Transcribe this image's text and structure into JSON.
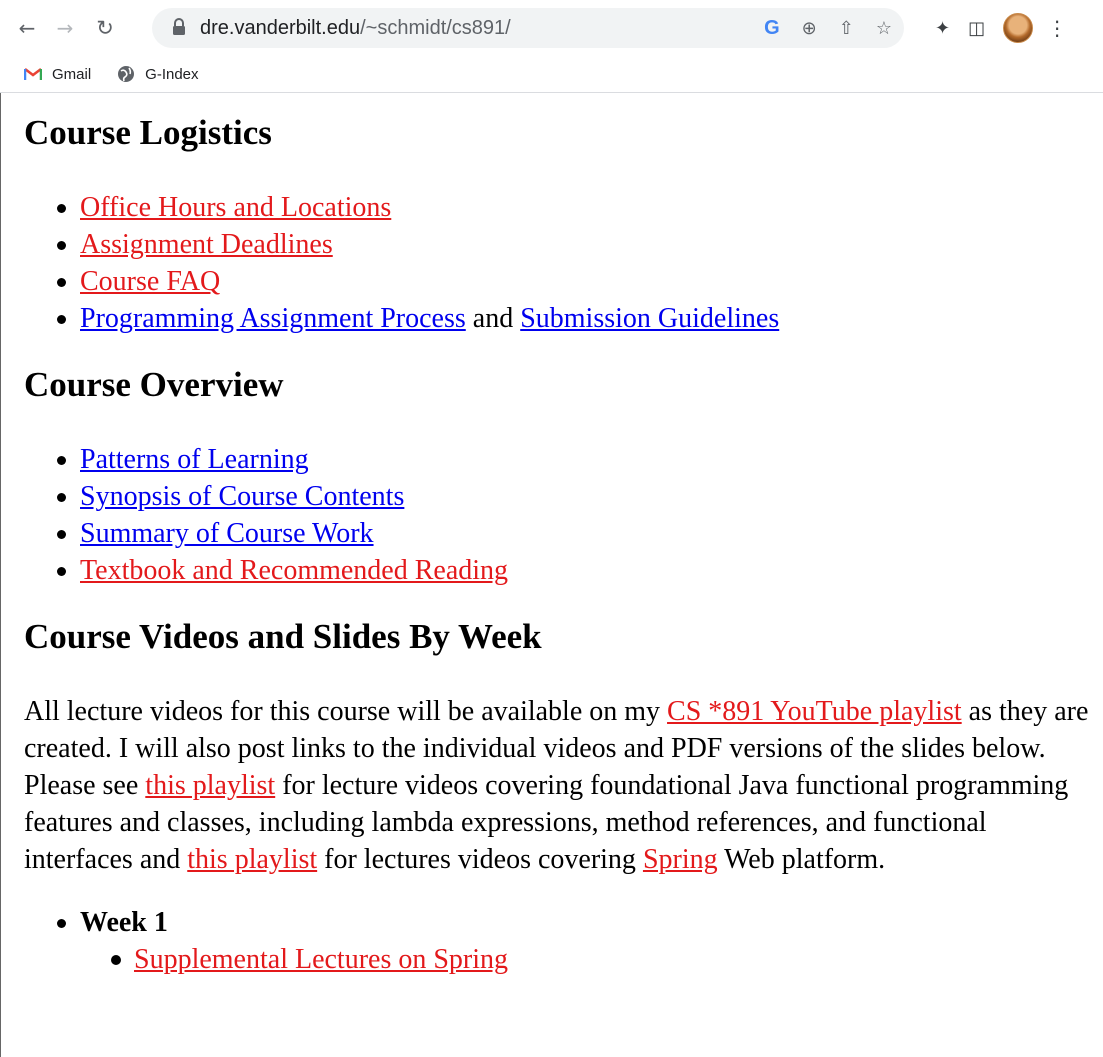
{
  "browser": {
    "url_host": "dre.vanderbilt.edu",
    "url_path": "/~schmidt/cs891/",
    "icons": [
      "back-icon",
      "forward-icon",
      "reload-icon",
      "lock-icon",
      "google-icon",
      "zoom-icon",
      "share-icon",
      "star-icon",
      "extensions-icon",
      "sidepanel-icon",
      "avatar",
      "menu-icon"
    ],
    "bookmarks": [
      {
        "label": "Gmail",
        "icon": "gmail-icon"
      },
      {
        "label": "G-Index",
        "icon": "globe-icon"
      }
    ],
    "google_letter": "G"
  },
  "sections": {
    "logistics": {
      "title": "Course Logistics",
      "items": [
        {
          "label": "Office Hours and Locations",
          "color": "red"
        },
        {
          "label": "Assignment Deadlines",
          "color": "red"
        },
        {
          "label": "Course FAQ",
          "color": "red"
        },
        {
          "label": "Programming Assignment Process",
          "color": "blue",
          "joiner": "and",
          "label2": "Submission Guidelines",
          "color2": "blue"
        }
      ]
    },
    "overview": {
      "title": "Course Overview",
      "items": [
        {
          "label": "Patterns of Learning",
          "color": "blue"
        },
        {
          "label": "Synopsis of Course Contents",
          "color": "blue"
        },
        {
          "label": "Summary of Course Work",
          "color": "blue"
        },
        {
          "label": "Textbook and Recommended Reading",
          "color": "red"
        }
      ]
    },
    "videos": {
      "title": "Course Videos and Slides By Week",
      "intro": {
        "t1": "All lecture videos for this course will be available on my ",
        "link1": "CS *891 YouTube playlist",
        "t2": " as they are created. I will also post links to the individual videos and PDF versions of the slides below. Please see ",
        "link2": "this playlist",
        "t3": " for lecture videos covering foundational Java functional programming features and classes, including lambda expressions, method references, and functional interfaces and ",
        "link3": "this playlist",
        "t4": " for lectures videos covering ",
        "link4": "Spring",
        "t5": " Web platform."
      },
      "weeks": [
        {
          "label": "Week 1",
          "items": [
            "Supplemental Lectures on Spring"
          ]
        }
      ]
    }
  },
  "colors": {
    "link_blue": "#0000ee",
    "link_red": "#e3191b"
  }
}
